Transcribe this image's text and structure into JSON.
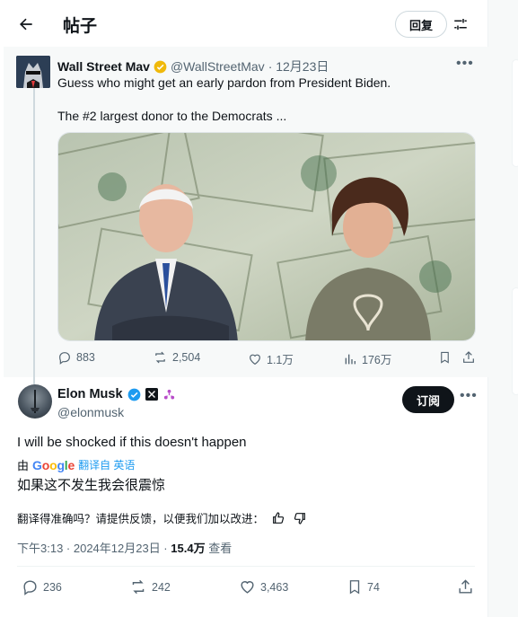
{
  "header": {
    "title": "帖子",
    "reply_label": "回复"
  },
  "parent_tweet": {
    "name": "Wall Street Mav",
    "handle": "@WallStreetMav",
    "date": "· 12月23日",
    "text1": "Guess who might get an early pardon from President Biden.",
    "text2": "The #2 largest donor to the Democrats ...",
    "stats": {
      "replies": "883",
      "reposts": "2,504",
      "likes": "1.1万",
      "views": "176万"
    }
  },
  "main_tweet": {
    "name": "Elon Musk",
    "handle": "@elonmusk",
    "subscribe_label": "订阅",
    "text": "I will be shocked if this doesn't happen",
    "translated_by_prefix": "由",
    "translated_by_brand": "Google",
    "translated_from": "翻译自 英语",
    "translation": "如果这不发生我会很震惊",
    "feedback_prompt": "翻译得准确吗？请提供反馈，以便我们加以改进：",
    "time": "下午3:13 · 2024年12月23日 ·",
    "views_count": "15.4万",
    "views_label": "查看",
    "stats": {
      "replies": "236",
      "reposts": "242",
      "likes": "3,463",
      "bookmarks": "74"
    }
  },
  "colors": {
    "verified_gold": "#f0b90b",
    "verified_blue": "#1d9bf0",
    "link_blue": "#1d9bf0",
    "muted": "#536471"
  }
}
